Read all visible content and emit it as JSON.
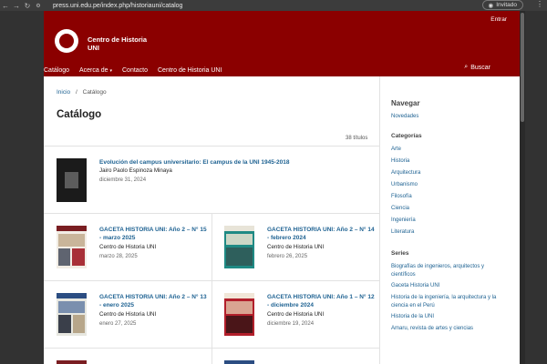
{
  "browser": {
    "url": "press.uni.edu.pe/index.php/historiauni/catalog",
    "profile": "Invitado"
  },
  "header": {
    "login": "Entrar",
    "site_name_line1": "Centro de Historia",
    "site_name_line2": "UNI",
    "nav": [
      "Catálogo",
      "Acerca de",
      "Contacto",
      "Centro de Historia UNI"
    ],
    "search": "Buscar"
  },
  "breadcrumb": {
    "home": "Inicio",
    "sep": "/",
    "current": "Catálogo"
  },
  "page_title": "Catálogo",
  "count": "38 títulos",
  "featured": {
    "title": "Evolución del campus universitario: El campus de la UNI 1945-2018",
    "author": "Jairo Paolo Espinoza Minaya",
    "date": "diciembre 31, 2024"
  },
  "items": [
    {
      "title_l1": "GACETA HISTORIA UNI: Año 2 – N° 15",
      "title_l2": "- marzo 2025",
      "author": "Centro de Historia UNI",
      "date": "marzo 28, 2025"
    },
    {
      "title_l1": "GACETA HISTORIA UNI: Año 2 – N° 14",
      "title_l2": "- febrero 2024",
      "author": "Centro de Historia UNI",
      "date": "febrero 26, 2025"
    },
    {
      "title_l1": "GACETA HISTORIA UNI: Año 2 – N° 13",
      "title_l2": "- enero 2025",
      "author": "Centro de Historia UNI",
      "date": "enero 27, 2025"
    },
    {
      "title_l1": "GACETA HISTORIA UNI: Año 1 – N° 12",
      "title_l2": "- diciembre 2024",
      "author": "Centro de Historia UNI",
      "date": "diciembre 19, 2024"
    }
  ],
  "sidebar": {
    "nav_heading": "Navegar",
    "nav_link": "Novedades",
    "categories_heading": "Categorías",
    "categories": [
      "Arte",
      "Historia",
      "Arquitectura",
      "Urbanismo",
      "Filosofía",
      "Ciencia",
      "Ingeniería",
      "Literatura"
    ],
    "series_heading": "Series",
    "series": [
      "Biografías de ingenieros, arquitectos y científicos",
      "Gaceta Historia UNI",
      "Historia de la ingeniería, la arquitectura y la ciencia en el Perú",
      "Historia de la UNI",
      "Amaru, revista de artes y ciencias"
    ]
  },
  "colors": {
    "brand": "#8b0000",
    "link": "#1e6292"
  }
}
